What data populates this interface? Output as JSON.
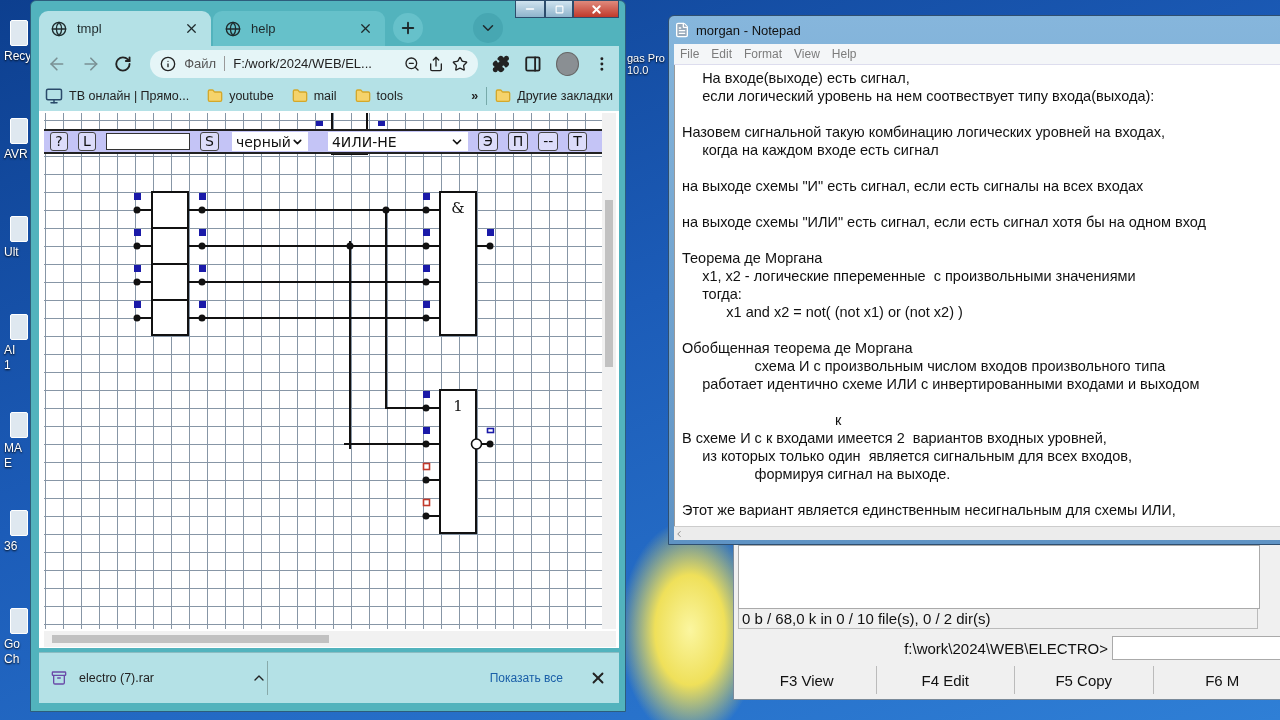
{
  "desktop": {
    "icons": [
      {
        "lines": [
          "Recy"
        ]
      },
      {
        "lines": [
          "AVR"
        ]
      },
      {
        "lines": [
          "Ult"
        ]
      },
      {
        "lines": [
          "AI",
          "1"
        ]
      },
      {
        "lines": [
          "MA",
          "E"
        ]
      },
      {
        "lines": [
          "36"
        ]
      },
      {
        "lines": [
          "Go",
          "Ch"
        ]
      }
    ],
    "right_icon": {
      "lines": [
        "gas Pro",
        "10.0"
      ]
    }
  },
  "browser": {
    "tabs": [
      {
        "title": "tmpl",
        "selected": true
      },
      {
        "title": "help",
        "selected": false
      }
    ],
    "address": {
      "scheme": "Файл",
      "url": "F:/work/2024/WEB/EL..."
    },
    "bookmarks": [
      {
        "kind": "site",
        "label": "ТВ онлайн | Прямо..."
      },
      {
        "kind": "folder",
        "label": "youtube"
      },
      {
        "kind": "folder",
        "label": "mail"
      },
      {
        "kind": "folder",
        "label": "tools"
      }
    ],
    "bookmarks_overflow": "»",
    "other_bookmarks": "Другие закладки",
    "page": {
      "toolbar": [
        {
          "kind": "button",
          "label": "?"
        },
        {
          "kind": "button",
          "label": "L"
        },
        {
          "kind": "input"
        },
        {
          "kind": "button",
          "label": "S"
        },
        {
          "kind": "select",
          "value": "черный"
        },
        {
          "kind": "select",
          "value": "4ИЛИ-НЕ"
        },
        {
          "kind": "button",
          "label": "Э"
        },
        {
          "kind": "button",
          "label": "П"
        },
        {
          "kind": "button",
          "label": "--"
        },
        {
          "kind": "button",
          "label": "Т"
        }
      ],
      "circuit": {
        "gates": [
          {
            "label": "&",
            "inverted_output": false,
            "input_signals": [
              true,
              true,
              true,
              true
            ],
            "output_signal": true
          },
          {
            "label": "1",
            "inverted_output": true,
            "input_signals": [
              true,
              true,
              false,
              false
            ],
            "output_signal": false
          }
        ]
      }
    },
    "downloads": {
      "file": "electro (7).rar",
      "show_all": "Показать все"
    }
  },
  "notepad": {
    "title": "morgan - Notepad",
    "menu": [
      "File",
      "Edit",
      "Format",
      "View",
      "Help"
    ],
    "paragraphs": [
      [
        "     На входе(выходе) есть сигнал,",
        "     если логический уровень на нем соотвествует типу входа(выхода):"
      ],
      [
        "Назовем сигнальной такую комбинацию логических уровней на входах,",
        "     когда на каждом входе есть сигнал"
      ],
      [
        "на выходе схемы \"И\" есть сигнал, если есть сигналы на всех входах"
      ],
      [
        "на выходе схемы \"ИЛИ\" есть сигнал, если есть сигнал хотя бы на одном вход"
      ],
      [
        "Теорема де Моргана",
        "     x1, x2 - логические ппеременные  с произвольными значениями",
        "     тогда:",
        "           x1 and x2 = not( (not x1) or (not x2) )"
      ],
      [
        "Обобщенная теорема де Моргана",
        "                  схема И с произвольным числом входов произвольного типа",
        "     работает идентично схеме ИЛИ с инвертированными входами и выходом"
      ],
      [
        "                                      к",
        "В схеме И с к входами имеется 2  вариантов входных уровней,",
        "     из которых только один  является сигнальным для всех входов,",
        "                  формируя сигнал на выходе."
      ],
      [
        "Этот же вариант является единственным несигнальным для схемы ИЛИ,"
      ]
    ]
  },
  "file_manager": {
    "status": "0 b / 68,0 k in 0 / 10 file(s), 0 / 2 dir(s)",
    "prompt": "f:\\work\\2024\\WEB\\ELECTRO>",
    "function_keys": [
      "F3 View",
      "F4 Edit",
      "F5 Copy",
      "F6 M"
    ]
  }
}
